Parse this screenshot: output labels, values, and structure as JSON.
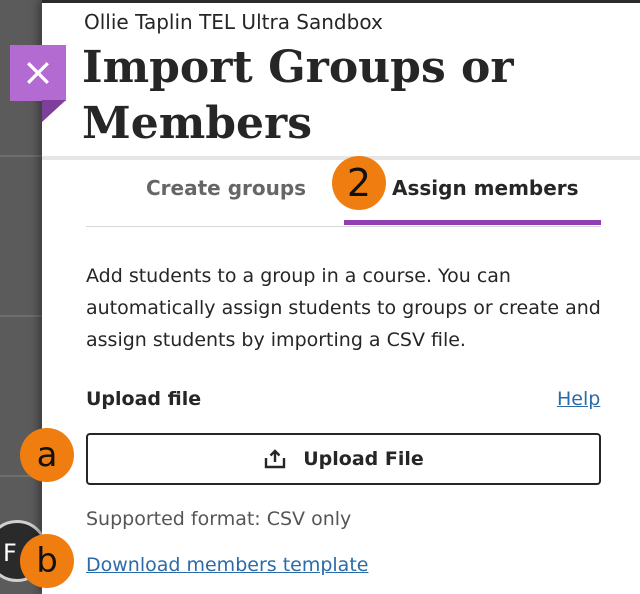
{
  "header": {
    "course_name": "Ollie Taplin TEL Ultra Sandbox",
    "title": "Import Groups or Members",
    "close_icon": "close-icon"
  },
  "tabs": [
    {
      "label": "Create groups",
      "active": false
    },
    {
      "label": "Assign members",
      "active": true
    }
  ],
  "content": {
    "description": "Add students to a group in a course. You can automatically assign students to groups or create and assign students by importing a CSV file.",
    "upload_label": "Upload file",
    "help_link": "Help",
    "upload_button_label": "Upload File",
    "upload_icon": "upload-icon",
    "supported_format": "Supported format: CSV only",
    "download_link": "Download members template"
  },
  "annotations": {
    "step_marker": "2",
    "marker_a": "a",
    "marker_b": "b"
  },
  "background": {
    "avatar_text": "F"
  },
  "colors": {
    "accent": "#8f3fb0",
    "close_button": "#b36ad1",
    "link": "#2a6ba8",
    "marker": "#f07d0f"
  }
}
